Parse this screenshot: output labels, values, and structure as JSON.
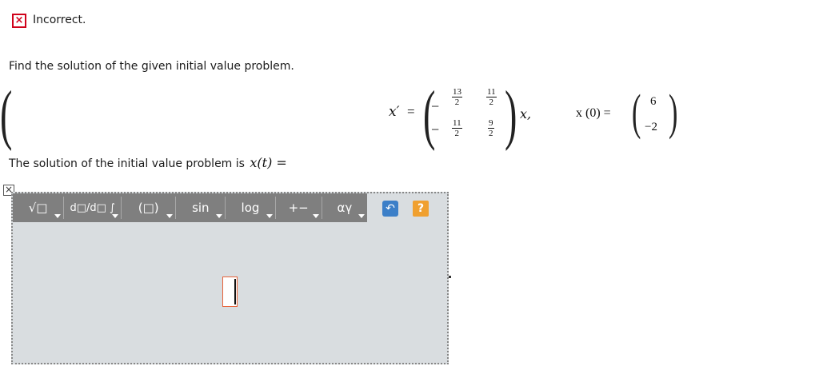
{
  "status": {
    "icon": "close-icon",
    "glyph": "×",
    "text": "Incorrect.",
    "color": "#d0021b"
  },
  "question": {
    "text": "Find the solution of the given initial value problem."
  },
  "equation": {
    "lhs": "x′",
    "equals": "=",
    "matrix": [
      [
        {
          "sign": "−",
          "num": "13",
          "den": "2"
        },
        {
          "sign": "",
          "num": "11",
          "den": "2"
        }
      ],
      [
        {
          "sign": "−",
          "num": "11",
          "den": "2"
        },
        {
          "sign": "",
          "num": "9",
          "den": "2"
        }
      ]
    ],
    "rhs_var": "x,",
    "initial_lhs": "x (0) =",
    "initial_vector": [
      "6",
      "−2"
    ]
  },
  "answer": {
    "label": "The solution of the initial value problem is",
    "expr": "x(t) ="
  },
  "editor": {
    "close_glyph": "×",
    "toolbar": [
      {
        "name": "radical-button",
        "label": "√□",
        "icon": "radical-icon"
      },
      {
        "name": "derivative-button",
        "label": "d□/d□ ∫",
        "icon": "derivative-icon"
      },
      {
        "name": "parentheses-button",
        "label": "(□)",
        "icon": "parentheses-icon"
      },
      {
        "name": "trig-button",
        "label": "sin"
      },
      {
        "name": "log-button",
        "label": "log"
      },
      {
        "name": "operators-button",
        "label": "+−"
      },
      {
        "name": "greek-button",
        "label": "αγ"
      }
    ],
    "undo_glyph": "↶",
    "help_glyph": "?",
    "toolbar_color": "#7f7f7f",
    "canvas_color": "#d9dde0",
    "undo_color": "#3c7fc8",
    "help_color": "#f0a030"
  }
}
